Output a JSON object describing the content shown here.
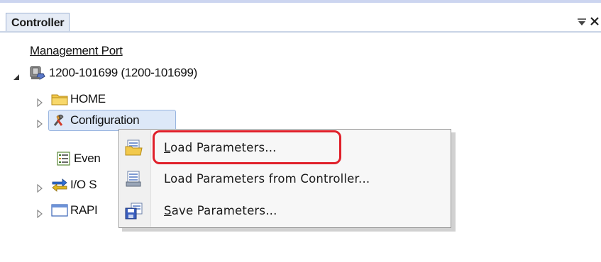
{
  "panel": {
    "title": "Controller",
    "pin_glyph": "⩡",
    "close_glyph": "✕"
  },
  "tree": {
    "management_port": "Management Port",
    "controller_node": {
      "label": "1200-101699 (1200-101699)",
      "icon": "controller-icon"
    },
    "children": [
      {
        "label": "HOME",
        "icon": "folder-icon"
      },
      {
        "label": "Configuration",
        "visible_label": "Configuration",
        "icon": "configuration-icon",
        "selected": true
      },
      {
        "label": "Even",
        "icon": "event-log-icon"
      },
      {
        "label": "I/O S",
        "icon": "io-system-icon"
      },
      {
        "label": "RAPI",
        "icon": "rapid-icon"
      }
    ]
  },
  "context_menu": {
    "items": [
      {
        "label_first": "L",
        "label_rest": "oad Parameters...",
        "icon": "load-parameters-icon",
        "highlighted": true
      },
      {
        "label": "Load Parameters from Controller...",
        "icon": "load-parameters-from-controller-icon"
      },
      {
        "label_first": "S",
        "label_rest": "ave Parameters...",
        "icon": "save-parameters-icon"
      }
    ]
  },
  "colors": {
    "highlight_outline": "#e0202a",
    "selection_fill": "#dde8f8",
    "tab_fill": "#e6ecf6"
  }
}
